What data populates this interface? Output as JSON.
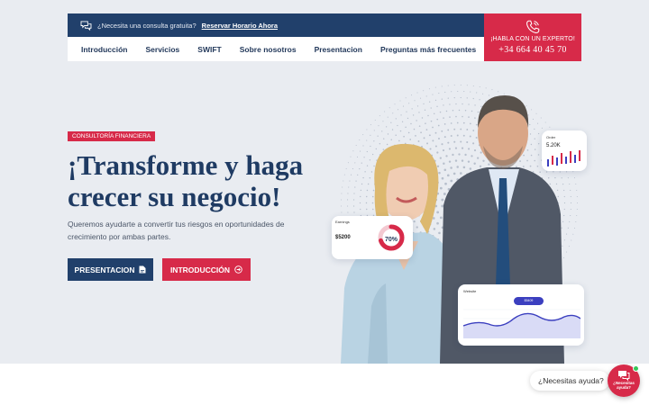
{
  "header": {
    "consult_question": "¿Necesita una consulta gratuita?",
    "consult_link": "Reservar Horario Ahora",
    "nav": [
      "Introducción",
      "Servicios",
      "SWIFT",
      "Sobre nosotros",
      "Presentacion",
      "Preguntas más frecuentes"
    ],
    "expert_label": "¡HABLA CON UN EXPERTO!",
    "expert_phone": "+34 664 40 45 70"
  },
  "hero": {
    "badge": "CONSULTORÍA FINANCIERA",
    "headline": "¡Transforme y haga crecer su negocio!",
    "lead": "Queremos ayudarte a convertir tus riesgos en oportunidades de crecimiento por ambas partes.",
    "btn_presentation": "PRESENTACION",
    "btn_intro": "INTRODUCCIÓN"
  },
  "cards": {
    "orders_title": "Order",
    "orders_value": "5.20K",
    "earnings_title": "Earnings",
    "earnings_value": "$5200",
    "earnings_percent": "70%",
    "earnings_progress": 0.7,
    "website_title": "Website",
    "website_tooltip": "$5409"
  },
  "chat": {
    "prompt": "¿Necesitas ayuda?",
    "bubble_label": "¿Necesitas ayuda?"
  },
  "colors": {
    "navy": "#21406b",
    "brand_red": "#d72a49",
    "hero_bg": "#e9ecf1"
  },
  "icons": [
    "chat-icon",
    "phone-icon",
    "document-icon",
    "arrow-circle-right-icon",
    "message-icon"
  ]
}
